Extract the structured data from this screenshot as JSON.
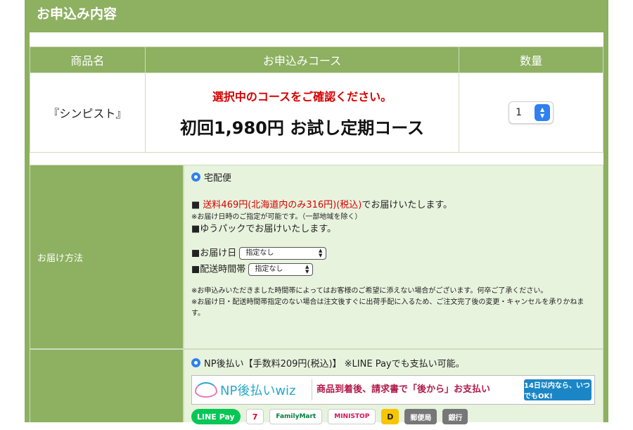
{
  "section": {
    "title": "お申込み内容"
  },
  "product_table": {
    "headers": [
      "商品名",
      "お申込みコース",
      "数量"
    ],
    "product_name": "『シンピスト』",
    "notice": "選択中のコースをご確認ください。",
    "course": "初回1,980円 お試し定期コース",
    "quantity": "1"
  },
  "delivery": {
    "label": "お届け方法",
    "option": "宅配便",
    "shipping_fee": "送料469円(北海道内のみ316円)(税込)",
    "shipping_suffix": "でお届けいたします。",
    "note_date": "※お届け日時のご指定が可能です。（一部地域を除く）",
    "yupack": "■ゆうパックでお届けいたします。",
    "date_label": "■お届け日",
    "date_value": "指定なし",
    "time_label": "■配送時間帯",
    "time_value": "指定なし",
    "note1": "※お申込みいただきました時間帯によってはお客様のご希望に添えない場合がございます。何卒ご了承ください。",
    "note2": "※お届け日・配送時間帯指定のない場合は注文後すぐに出荷手配に入るため、ご注文完了後の変更・キャンセルを承りかねます。"
  },
  "payment": {
    "option": "NP後払い【手数料209円(税込)】 ※LINE Payでも支払い可能。",
    "np_logo": "NP後払いwiz",
    "np_message": "商品到着後、請求書で「後から」お支払い",
    "np_badge": "14日以内なら、いつでもOK!",
    "logos": [
      "LINE Pay",
      "7",
      "FamilyMart",
      "MINISTOP",
      "D",
      "郵便局",
      "銀行"
    ]
  },
  "colors": {
    "green": "#8db061",
    "light_green": "#e8f3de",
    "red": "#d60000",
    "blue": "#2f80f0"
  }
}
